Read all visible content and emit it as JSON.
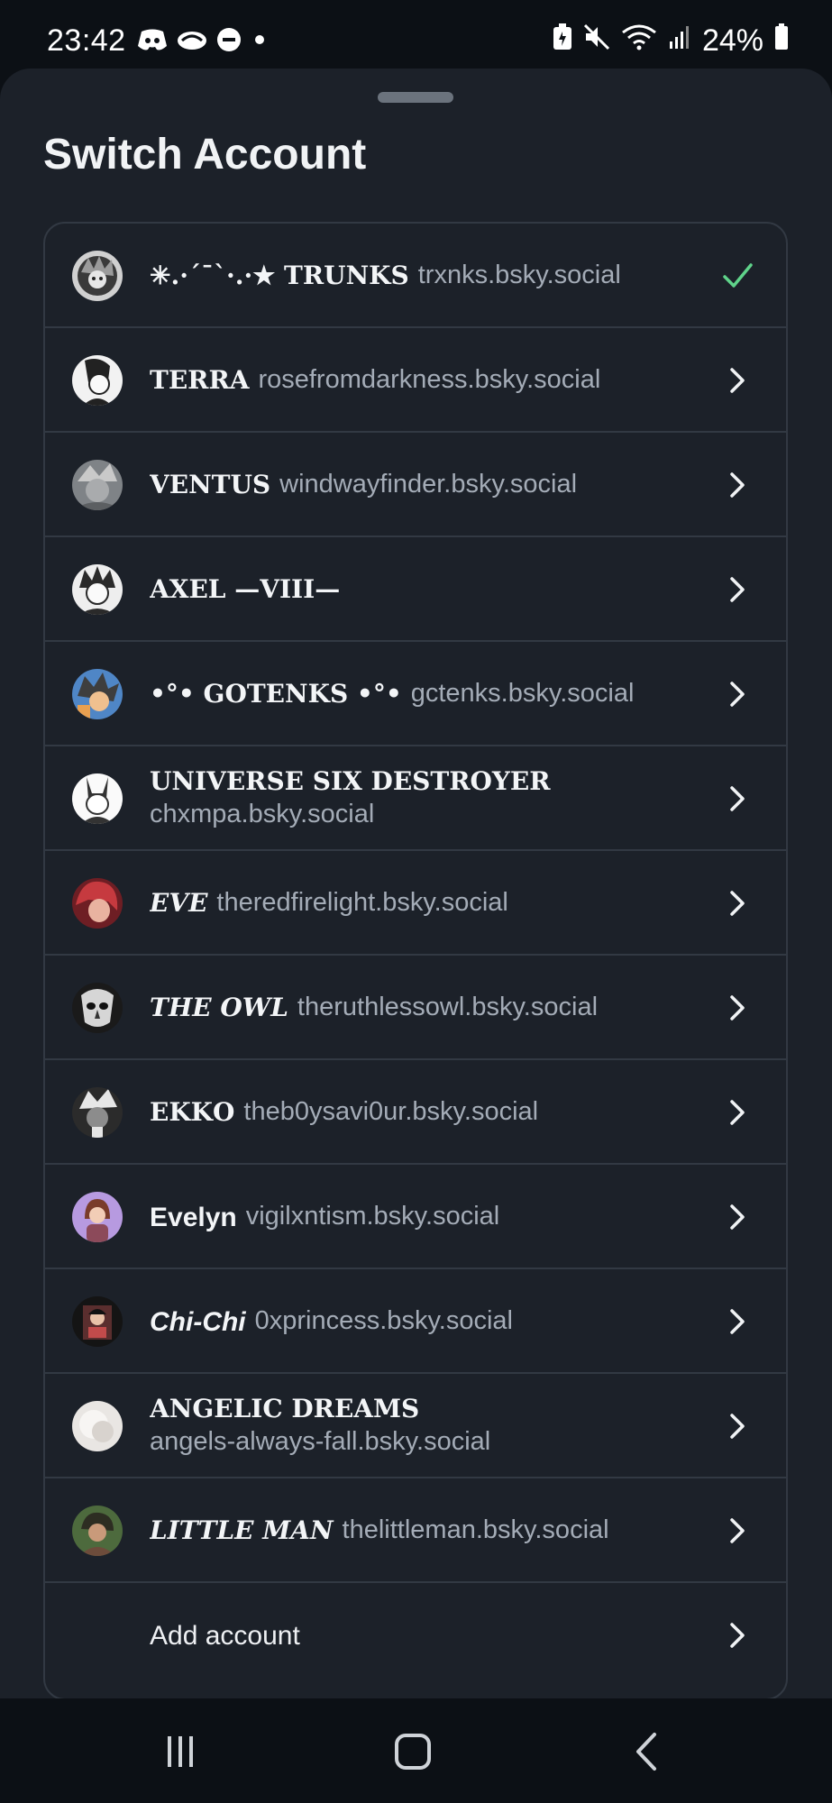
{
  "status_bar": {
    "time": "23:42",
    "battery": "24%",
    "left_icons": [
      "discord-icon",
      "cloud-icon",
      "dnd-icon",
      "dot-icon"
    ],
    "right_icons": [
      "battery-saver-icon",
      "mute-icon",
      "wifi-icon",
      "signal-icon",
      "battery-icon"
    ]
  },
  "sheet": {
    "title": "Switch Account"
  },
  "accounts": [
    {
      "name": "✳︎.·´¯`·.·★ 𝐓𝐑𝐔𝐍𝐊𝐒",
      "handle": "trxnks.bsky.social",
      "current": true,
      "avatar_color": "#9aa0a6"
    },
    {
      "name": "𝐓𝐄𝐑𝐑𝐀",
      "handle": "rosefromdarkness.bsky.social",
      "avatar_color": "#e8e8e8"
    },
    {
      "name": "𝐕𝐄𝐍𝐓𝐔𝐒",
      "handle": "windwayfinder.bsky.social",
      "avatar_color": "#8a8d91"
    },
    {
      "name": "𝐀𝐗𝐄𝐋 —𝐕𝐈𝐈𝐈—",
      "handle": "",
      "avatar_color": "#d9d9d9"
    },
    {
      "name": "•°• 𝐆𝐎𝐓𝐄𝐍𝐊𝐒 •°•",
      "handle": "gctenks.bsky.social",
      "avatar_color": "#5f8fc9"
    },
    {
      "name": "𝐔𝐍𝐈𝐕𝐄𝐑𝐒𝐄 𝐒𝐈𝐗 𝐃𝐄𝐒𝐓𝐑𝐎𝐘𝐄𝐑",
      "handle": "chxmpa.bsky.social",
      "avatar_color": "#dcdcdc"
    },
    {
      "name": "𝑬𝑽𝑬",
      "handle": "theredfirelight.bsky.social",
      "avatar_color": "#b4323a"
    },
    {
      "name": "𝑻𝑯𝑬 𝑶𝑾𝑳",
      "handle": "theruthlessowl.bsky.social",
      "avatar_color": "#2c2c2c"
    },
    {
      "name": "𝐄𝐊𝐊𝐎",
      "handle": "theb0ysavi0ur.bsky.social",
      "avatar_color": "#5a5a5a"
    },
    {
      "name": "Evelyn",
      "handle": "vigilxntism.bsky.social",
      "avatar_color": "#b79ae0"
    },
    {
      "name": "Chi-Chi",
      "handle": "0xprincess.bsky.social",
      "avatar_color": "#3a2a2a"
    },
    {
      "name": "𝐀𝐍𝐆𝐄𝐋𝐈𝐂 𝐃𝐑𝐄𝐀𝐌𝐒",
      "handle": "angels-always-fall.bsky.social",
      "avatar_color": "#e9e6e3"
    },
    {
      "name": "𝑳𝑰𝑻𝑻𝑳𝑬 𝑴𝑨𝑵",
      "handle": "thelittleman.bsky.social",
      "avatar_color": "#4d6a3d"
    }
  ],
  "add_account": {
    "label": "Add account"
  },
  "colors": {
    "accent_check": "#5fd38a",
    "sheet_bg": "#1c2129",
    "border": "#323943"
  }
}
